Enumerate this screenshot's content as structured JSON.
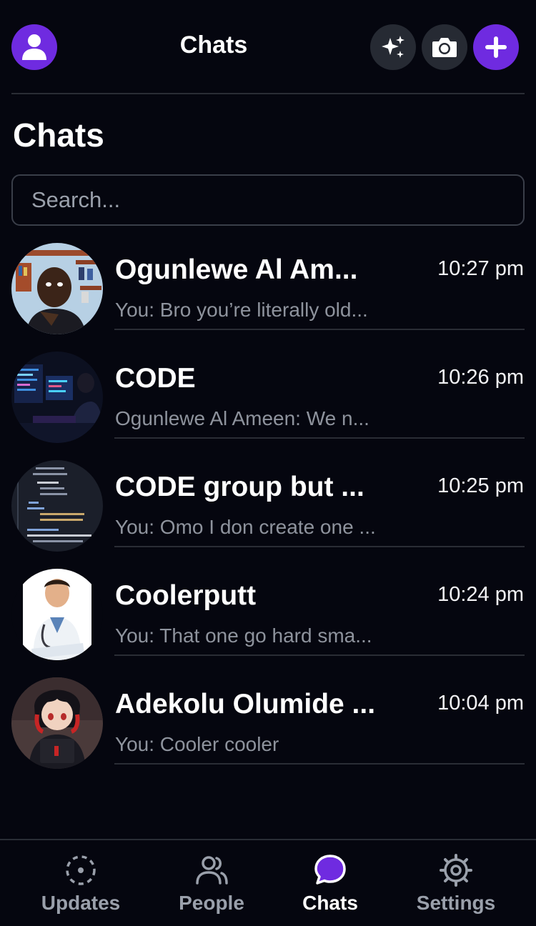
{
  "header": {
    "title": "Chats",
    "buttons": [
      "sparkle-icon",
      "camera-icon",
      "plus-icon"
    ]
  },
  "section_title": "Chats",
  "search": {
    "placeholder": "Search...",
    "value": ""
  },
  "chats": [
    {
      "name": "Ogunlewe Al Am...",
      "time": "10:27 pm",
      "preview": "You: Bro you’re literally old..."
    },
    {
      "name": "CODE",
      "time": "10:26 pm",
      "preview": "Ogunlewe Al Ameen: We n..."
    },
    {
      "name": "CODE group but ...",
      "time": "10:25 pm",
      "preview": "You: Omo I don create one ..."
    },
    {
      "name": "Coolerputt",
      "time": "10:24 pm",
      "preview": "You: That one go hard sma..."
    },
    {
      "name": "Adekolu Olumide ...",
      "time": "10:04 pm",
      "preview": "You: Cooler cooler"
    }
  ],
  "nav": [
    {
      "label": "Updates",
      "icon": "updates-icon"
    },
    {
      "label": "People",
      "icon": "people-icon"
    },
    {
      "label": "Chats",
      "icon": "chat-bubble-icon",
      "active": true
    },
    {
      "label": "Settings",
      "icon": "gear-icon"
    }
  ],
  "colors": {
    "accent": "#6f2be0",
    "background": "#05060f",
    "muted": "#8e939d"
  }
}
